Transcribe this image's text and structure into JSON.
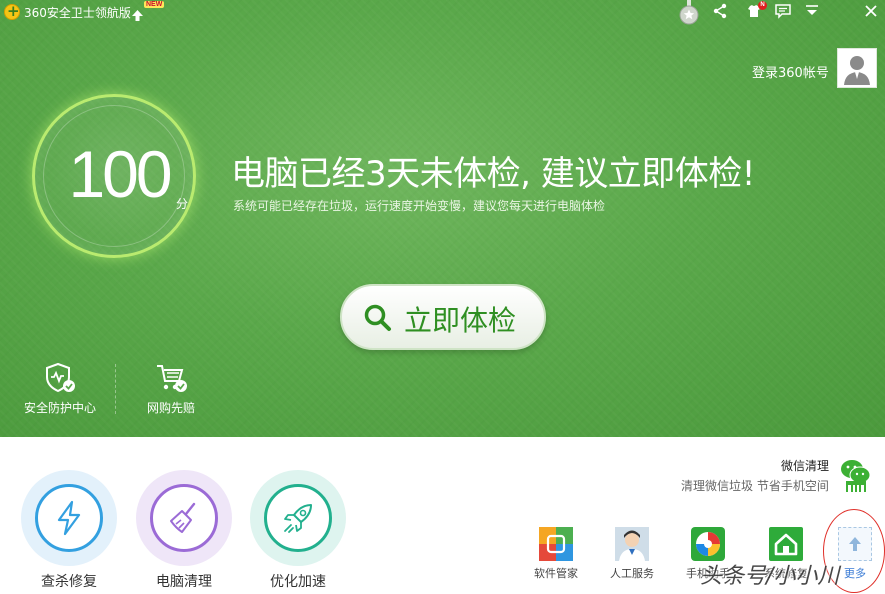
{
  "window": {
    "title": "360安全卫士领航版",
    "new_badge": "NEW",
    "skin_badge": "N"
  },
  "account": {
    "login_label": "登录360帐号"
  },
  "score": {
    "value": "100",
    "unit": "分"
  },
  "message": {
    "headline": "电脑已经3天未体检, 建议立即体检!",
    "subline": "系统可能已经存在垃圾，运行速度开始变慢，建议您每天进行电脑体检"
  },
  "exam_button": {
    "label": "立即体检"
  },
  "side_links": [
    {
      "label": "安全防护中心"
    },
    {
      "label": "网购先赔"
    }
  ],
  "tools": [
    {
      "label": "查杀修复",
      "color": "#33a0e0"
    },
    {
      "label": "电脑清理",
      "color": "#9b6bd6"
    },
    {
      "label": "优化加速",
      "color": "#22b08e"
    }
  ],
  "wechat_promo": {
    "title": "微信清理",
    "subtitle": "清理微信垃圾 节省手机空间"
  },
  "apps": [
    {
      "label": "软件管家",
      "icon": "software-manager-icon"
    },
    {
      "label": "人工服务",
      "icon": "human-service-icon"
    },
    {
      "label": "手机助手",
      "icon": "phone-assistant-icon"
    },
    {
      "label": "系统修复",
      "icon": "system-repair-icon"
    },
    {
      "label": "更多",
      "icon": "more-icon"
    }
  ],
  "watermark": "头条号/小小川",
  "colors": {
    "header_green": "#5aa84a",
    "button_green": "#2f8f22",
    "more_blue": "#3a7bd5"
  }
}
